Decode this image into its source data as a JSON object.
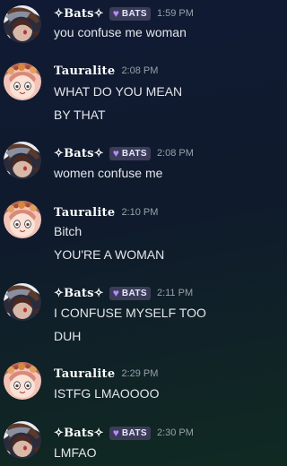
{
  "messages": [
    {
      "author": "✧Bats✧",
      "badge": "BATS",
      "time": "1:59 PM",
      "lines": [
        "you confuse me woman"
      ]
    },
    {
      "author": "Tauralite",
      "time": "2:08 PM",
      "lines": [
        "WHAT DO YOU MEAN",
        "BY THAT"
      ]
    },
    {
      "author": "✧Bats✧",
      "badge": "BATS",
      "time": "2:08 PM",
      "lines": [
        "women confuse me"
      ]
    },
    {
      "author": "Tauralite",
      "time": "2:10 PM",
      "lines": [
        "Bitch",
        "YOU'RE A WOMAN"
      ]
    },
    {
      "author": "✧Bats✧",
      "badge": "BATS",
      "time": "2:11 PM",
      "lines": [
        "I CONFUSE MYSELF TOO",
        "DUH"
      ]
    },
    {
      "author": "Tauralite",
      "time": "2:29 PM",
      "lines": [
        "ISTFG LMAOOOO"
      ]
    },
    {
      "author": "✧Bats✧",
      "badge": "BATS",
      "time": "2:30 PM",
      "lines": [
        "LMFAO"
      ]
    }
  ],
  "icons": {
    "badge": "purple-heart-icon"
  },
  "colors": {
    "badge_bg": "#3b3d58",
    "badge_heart": "#b58bff",
    "timestamp": "#9aa0aa"
  }
}
